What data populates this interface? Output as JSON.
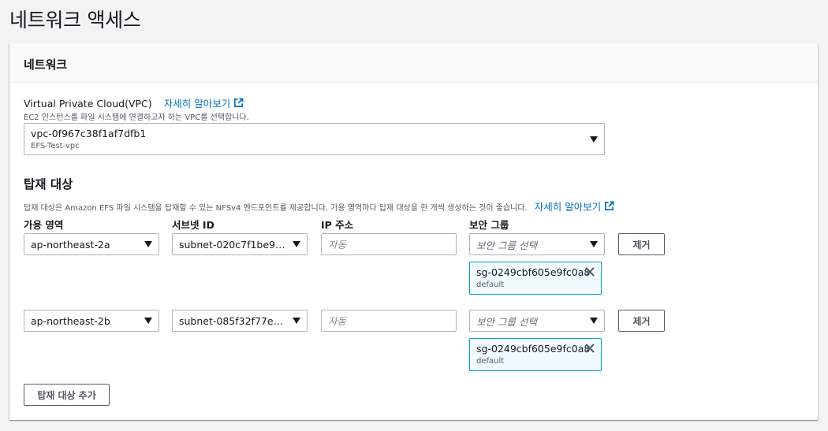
{
  "page": {
    "title": "네트워크 액세스"
  },
  "panel": {
    "title": "네트워크"
  },
  "vpc": {
    "label": "Virtual Private Cloud(VPC)",
    "learn_more": "자세히 알아보기",
    "description": "EC2 인스턴스를 파일 시스템에 연결하고자 하는 VPC를 선택합니다.",
    "selected_id": "vpc-0f967c38f1af7dfb1",
    "selected_name": "EFS-Test-vpc"
  },
  "mount": {
    "title": "탑재 대상",
    "description": "탑재 대상은 Amazon EFS 파일 시스템을 탑재할 수 있는 NFSv4 엔드포인트를 제공합니다. 가용 영역마다 탑재 대상을 한 개씩 생성하는 것이 좋습니다.",
    "learn_more": "자세히 알아보기",
    "columns": {
      "az": "가용 영역",
      "subnet": "서브넷 ID",
      "ip": "IP 주소",
      "sg": "보안 그룹"
    },
    "ip_placeholder": "자동",
    "sg_placeholder": "보안 그룹 선택",
    "remove_label": "제거",
    "add_label": "탑재 대상 추가",
    "rows": [
      {
        "az": "ap-northeast-2a",
        "subnet": "subnet-020c7f1be91...",
        "sg_name": "sg-0249cbf605e9fc0a8",
        "sg_desc": "default"
      },
      {
        "az": "ap-northeast-2b",
        "subnet": "subnet-085f32f77eb...",
        "sg_name": "sg-0249cbf605e9fc0a8",
        "sg_desc": "default"
      }
    ]
  },
  "colors": {
    "link": "#0073bb",
    "token_border": "#00a1c9",
    "token_bg": "#f1faff"
  }
}
